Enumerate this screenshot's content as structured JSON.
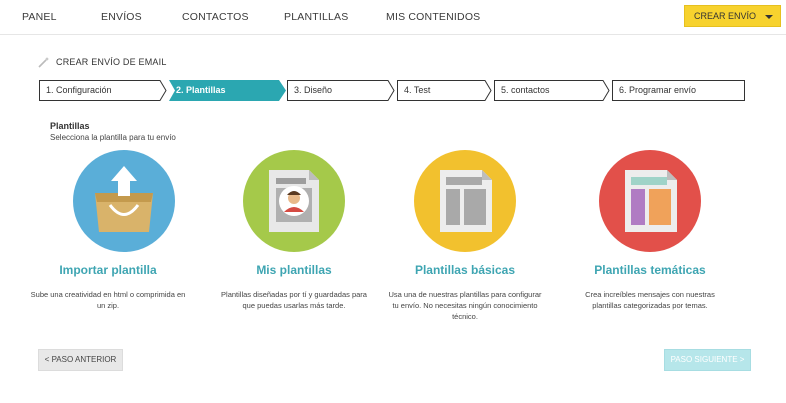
{
  "nav": {
    "items": [
      "PANEL",
      "ENVÍOS",
      "CONTACTOS",
      "PLANTILLAS",
      "MIS CONTENIDOS"
    ],
    "create_button": "CREAR ENVÍO"
  },
  "page": {
    "title": "CREAR ENVÍO DE EMAIL"
  },
  "steps": [
    {
      "label": "1. Configuración",
      "state": "done"
    },
    {
      "label": "2. Plantillas",
      "state": "active"
    },
    {
      "label": "3. Diseño",
      "state": "pending"
    },
    {
      "label": "4. Test",
      "state": "pending"
    },
    {
      "label": "5. contactos",
      "state": "pending"
    },
    {
      "label": "6. Programar envío",
      "state": "pending"
    }
  ],
  "section": {
    "title": "Plantillas",
    "subtitle": "Selecciona la plantilla para tu envío"
  },
  "options": [
    {
      "title": "Importar plantilla",
      "desc_lines": [
        "Sube una creatividad en html o comprimida en",
        "un zip."
      ],
      "icon": "upload-box-icon",
      "color": "#5aaed8"
    },
    {
      "title": "Mis plantillas",
      "desc_lines": [
        "Plantillas diseñadas por tí y guardadas para",
        "que puedas usarlas más tarde."
      ],
      "icon": "user-template-icon",
      "color": "#a5c94a"
    },
    {
      "title": "Plantillas básicas",
      "desc_lines": [
        "Usa una de nuestras plantillas para configurar",
        "tu envío. No necesitas ningún conocimiento",
        "técnico."
      ],
      "icon": "basic-template-icon",
      "color": "#f2c12e"
    },
    {
      "title": "Plantillas temáticas",
      "desc_lines": [
        "Crea increíbles mensajes con nuestras",
        "plantillas categorizadas por temas."
      ],
      "icon": "themed-template-icon",
      "color": "#e2504a"
    }
  ],
  "buttons": {
    "prev": "< PASO ANTERIOR",
    "next": "PASO SIGUIENTE >"
  },
  "colors": {
    "accent": "#2ba7b1",
    "create": "#f7d22e",
    "next_disabled": "#b6e6ea"
  }
}
